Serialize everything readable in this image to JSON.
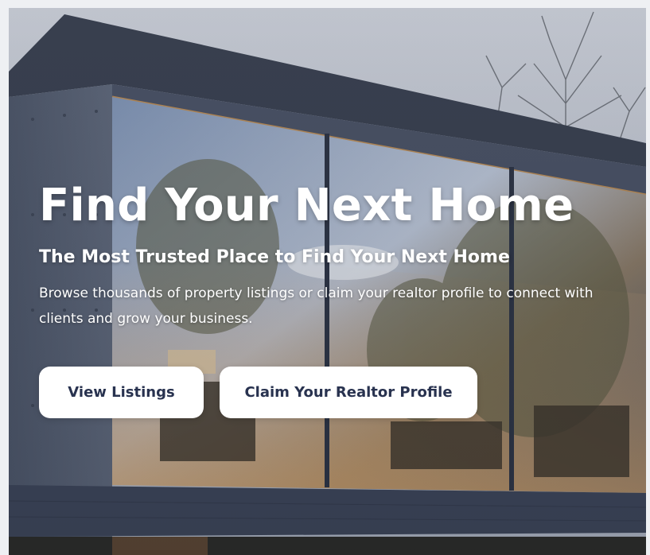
{
  "hero": {
    "title": "Find Your Next Home",
    "subtitle": "The Most Trusted Place to Find Your Next Home",
    "description": "Browse thousands of property listings or claim your realtor profile to connect with clients and grow your business."
  },
  "actions": {
    "view_listings_label": "View Listings",
    "claim_profile_label": "Claim Your Realtor Profile"
  },
  "colors": {
    "button_text": "#28324f",
    "button_bg": "#ffffff",
    "hero_text": "#ffffff"
  }
}
